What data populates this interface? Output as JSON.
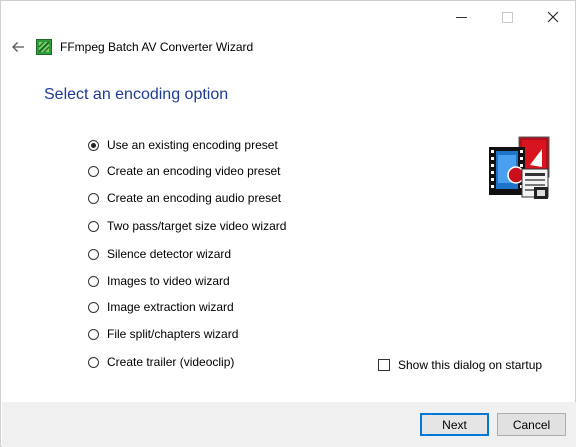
{
  "window": {
    "title": "FFmpeg Batch AV Converter Wizard"
  },
  "heading": "Select an encoding option",
  "options": [
    {
      "label": "Use an existing encoding preset",
      "selected": true
    },
    {
      "label": "Create an encoding video preset",
      "selected": false
    },
    {
      "label": "Create an encoding audio preset",
      "selected": false
    },
    {
      "label": "Two pass/target size video wizard",
      "selected": false
    },
    {
      "label": "Silence detector wizard",
      "selected": false
    },
    {
      "label": "Images to video wizard",
      "selected": false
    },
    {
      "label": "Image extraction wizard",
      "selected": false
    },
    {
      "label": "File split/chapters wizard",
      "selected": false
    },
    {
      "label": "Create trailer (videoclip)",
      "selected": false
    }
  ],
  "startup_checkbox": {
    "label": "Show this dialog on startup",
    "checked": false
  },
  "buttons": {
    "next": "Next",
    "cancel": "Cancel"
  },
  "colors": {
    "heading": "#1e3c96",
    "accent": "#0078d7",
    "footer_bg": "#f0f0f0"
  }
}
